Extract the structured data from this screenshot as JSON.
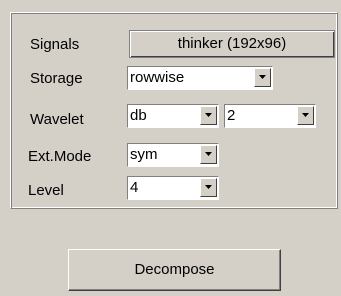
{
  "signals": {
    "label": "Signals",
    "value": "thinker (192x96)"
  },
  "storage": {
    "label": "Storage",
    "value": "rowwise"
  },
  "wavelet": {
    "label": "Wavelet",
    "family": "db",
    "order": "2"
  },
  "ext_mode": {
    "label": "Ext.Mode",
    "value": "sym"
  },
  "level": {
    "label": "Level",
    "value": "4"
  },
  "decompose_button": {
    "label": "Decompose"
  },
  "icons": {
    "dropdown": "chevron-down-icon"
  }
}
